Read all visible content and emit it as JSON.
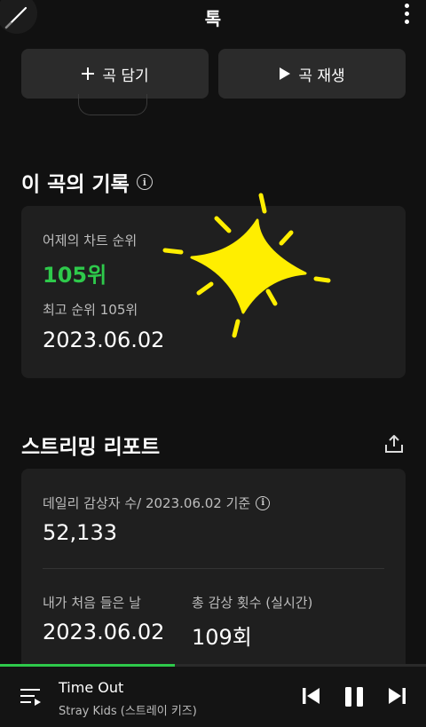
{
  "header": {
    "title": "톡"
  },
  "actions": {
    "add_label": "곡 담기",
    "play_label": "곡 재생"
  },
  "history": {
    "title": "이 곡의 기록",
    "yesterday_rank_label": "어제의 차트 순위",
    "yesterday_rank_value": "105위",
    "best_rank_label": "최고 순위 105위",
    "best_rank_date": "2023.06.02"
  },
  "report": {
    "title": "스트리밍 리포트",
    "daily_listeners_label": "데일리 감상자 수/ 2023.06.02 기준",
    "daily_listeners_value": "52,133",
    "first_listen_label": "내가 처음 들은 날",
    "first_listen_value": "2023.06.02",
    "total_plays_label": "총 감상 횟수 (실시간)",
    "total_plays_value": "109회"
  },
  "player": {
    "title": "Time Out",
    "artist": "Stray Kids (스트레이 키즈)",
    "progress": 0.41
  },
  "colors": {
    "accent": "#2ec94b",
    "sticker": "#ffee00",
    "card": "#1f1f1f",
    "background": "#111111"
  },
  "icons": [
    "pen-icon",
    "more-vertical-icon",
    "plus-icon",
    "play-icon",
    "info-icon",
    "share-icon",
    "queue-icon",
    "previous-icon",
    "pause-icon",
    "next-icon",
    "sparkle-sticker"
  ]
}
